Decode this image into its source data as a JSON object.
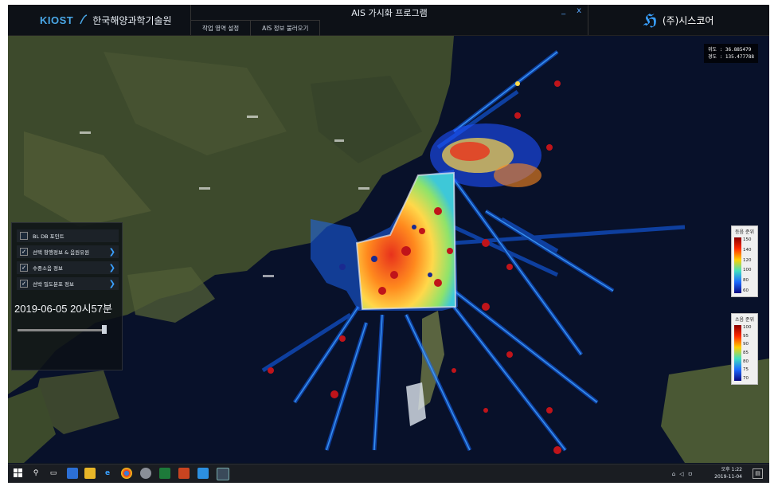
{
  "header": {
    "logo_brand": "KIOST",
    "org_name": "한국해양과학기술원",
    "app_title": "AIS 가시화 프로그램",
    "minimize_label": "_",
    "close_label": "x",
    "menu": [
      {
        "label": "작업 영역 설정"
      },
      {
        "label": "AIS 정보 불러오기"
      }
    ],
    "partner_name": "(주)시스코어"
  },
  "map": {
    "coordinates_lines": [
      "위도 : 36.885479",
      "경도 : 135.477788"
    ],
    "layers": [
      {
        "label": "BL DB 포인트",
        "checked": false,
        "has_arrow": false
      },
      {
        "label": "선택 항행정보 & 음원유원",
        "checked": true,
        "has_arrow": true
      },
      {
        "label": "수중소음 정보",
        "checked": true,
        "has_arrow": true
      },
      {
        "label": "선박 밀도분포 정보",
        "checked": true,
        "has_arrow": true
      }
    ],
    "datetime": "2019-06-05 20시57분",
    "time_progress": 1.0,
    "legend_top": {
      "title": "등음 준위",
      "ticks": [
        "150",
        "140",
        "120",
        "100",
        "80",
        "60"
      ]
    },
    "legend_bottom": {
      "title": "소음 준위",
      "ticks": [
        "100",
        "95",
        "90",
        "85",
        "80",
        "75",
        "70"
      ]
    },
    "colors": {
      "water": "#0a1228",
      "land": "#3b4a2a",
      "heat_high": "#e8321c",
      "heat_mid": "#ffd84a",
      "heat_low": "#1466ff"
    }
  },
  "taskbar": {
    "clock_time": "오후 1:22",
    "clock_date": "2019-11-04",
    "icons": [
      "windows-start",
      "search",
      "task-view",
      "edge-icon",
      "file-explorer",
      "ie",
      "chrome",
      "app-1",
      "excel",
      "powerpoint",
      "app-2",
      "ais-app"
    ]
  }
}
